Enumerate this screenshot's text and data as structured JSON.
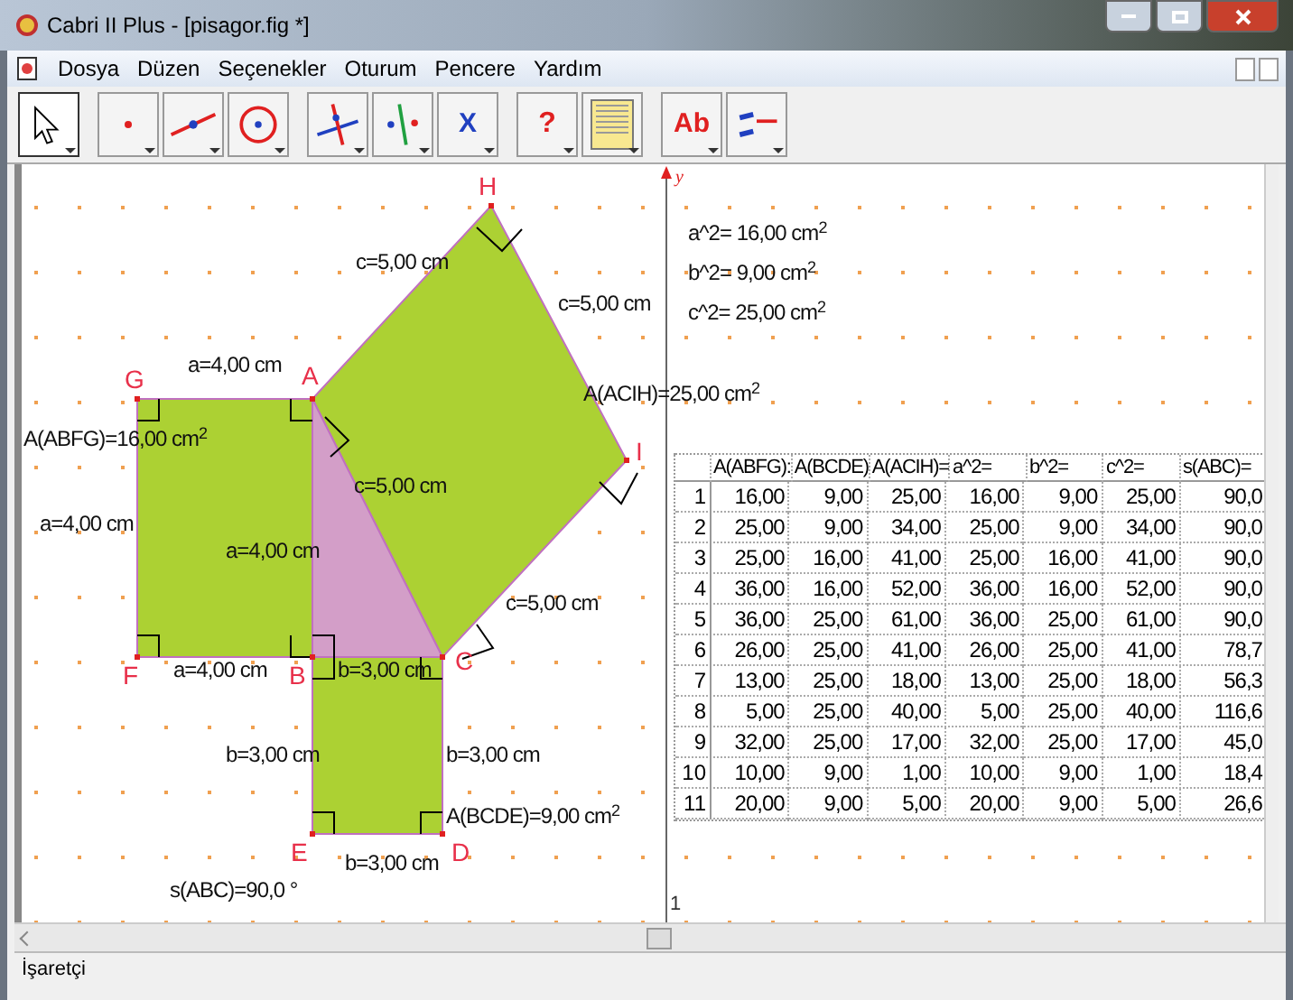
{
  "window": {
    "title": "Cabri II Plus - [pisagor.fig *]"
  },
  "menu": [
    "Dosya",
    "Düzen",
    "Seçenekler",
    "Oturum",
    "Pencere",
    "Yardım"
  ],
  "toolbar": [
    {
      "kind": "pointer",
      "selected": true
    },
    {
      "kind": "point",
      "selected": false
    },
    {
      "kind": "line",
      "selected": false
    },
    {
      "kind": "circle",
      "selected": false
    },
    {
      "kind": "perpendicular",
      "selected": false
    },
    {
      "kind": "symmetry",
      "selected": false
    },
    {
      "kind": "transform",
      "glyph": "X",
      "selected": false
    },
    {
      "kind": "check",
      "glyph": "?",
      "selected": false
    },
    {
      "kind": "table",
      "selected": false
    },
    {
      "kind": "text",
      "glyph": "Ab",
      "selected": false
    },
    {
      "kind": "display",
      "selected": false
    }
  ],
  "points": [
    "G",
    "A",
    "F",
    "B",
    "C",
    "E",
    "D",
    "H",
    "I"
  ],
  "labels": [
    "c=5,00 cm",
    "c=5,00 cm",
    "a=4,00 cm",
    "A(ACIH)=25,00 cm$^{2}$",
    "A(ABFG)=16,00 cm$^{2}$",
    "c=5,00 cm",
    "a=4,00 cm",
    "a=4,00 cm",
    "c=5,00 cm",
    "a=4,00 cm",
    "b=3,00 cm",
    "b=3,00 cm",
    "b=3,00 cm",
    "A(BCDE)=9,00 cm$^{2}$",
    "b=3,00 cm",
    "s(ABC)=90,0 °"
  ],
  "axis": {
    "name": "y",
    "tick": "1"
  },
  "measurements": [
    "a^2= 16,00 cm$^{2}$",
    "b^2= 9,00 cm$^{2}$",
    "c^2= 25,00 cm$^{2}$"
  ],
  "table": {
    "columns": [
      "A(ABFG):",
      "A(BCDE)",
      "A(ACIH)=",
      "a^2=",
      "b^2=",
      "c^2=",
      "s(ABC)="
    ],
    "rows": [
      {
        "number": "1",
        "cells": [
          "16,00",
          "9,00",
          "25,00",
          "16,00",
          "9,00",
          "25,00",
          "90,0"
        ]
      },
      {
        "number": "2",
        "cells": [
          "25,00",
          "9,00",
          "34,00",
          "25,00",
          "9,00",
          "34,00",
          "90,0"
        ]
      },
      {
        "number": "3",
        "cells": [
          "25,00",
          "16,00",
          "41,00",
          "25,00",
          "16,00",
          "41,00",
          "90,0"
        ]
      },
      {
        "number": "4",
        "cells": [
          "36,00",
          "16,00",
          "52,00",
          "36,00",
          "16,00",
          "52,00",
          "90,0"
        ]
      },
      {
        "number": "5",
        "cells": [
          "36,00",
          "25,00",
          "61,00",
          "36,00",
          "25,00",
          "61,00",
          "90,0"
        ]
      },
      {
        "number": "6",
        "cells": [
          "26,00",
          "25,00",
          "41,00",
          "26,00",
          "25,00",
          "41,00",
          "78,7"
        ]
      },
      {
        "number": "7",
        "cells": [
          "13,00",
          "25,00",
          "18,00",
          "13,00",
          "25,00",
          "18,00",
          "56,3"
        ]
      },
      {
        "number": "8",
        "cells": [
          "5,00",
          "25,00",
          "40,00",
          "5,00",
          "25,00",
          "40,00",
          "116,6"
        ]
      },
      {
        "number": "9",
        "cells": [
          "32,00",
          "25,00",
          "17,00",
          "32,00",
          "25,00",
          "17,00",
          "45,0"
        ]
      },
      {
        "number": "10",
        "cells": [
          "10,00",
          "9,00",
          "1,00",
          "10,00",
          "9,00",
          "1,00",
          "18,4"
        ]
      },
      {
        "number": "11",
        "cells": [
          "20,00",
          "9,00",
          "5,00",
          "20,00",
          "9,00",
          "5,00",
          "26,6"
        ]
      }
    ]
  },
  "status_bar": "İşaretçi"
}
